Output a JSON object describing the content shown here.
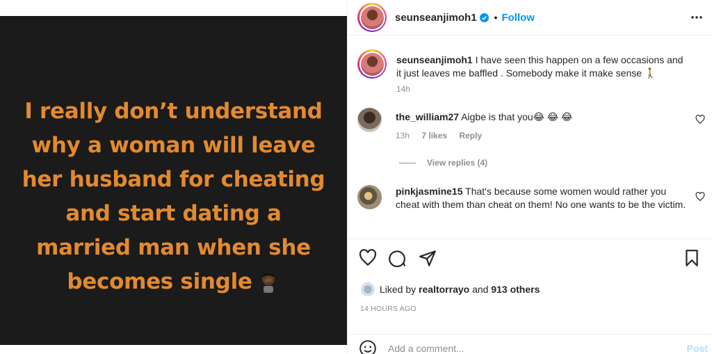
{
  "post_image": {
    "quote_lines": [
      "I really don’t understand",
      "why a woman will leave",
      "her husband for cheating",
      "and start dating a",
      "married man when she",
      "becomes single"
    ],
    "quote_color": "#e38a2f",
    "background": "#1b1b1b",
    "emoji_icon": "man-facepalming-icon"
  },
  "header": {
    "username": "seunseanjimoh1",
    "separator": "•",
    "follow_label": "Follow",
    "more_icon": "more-horizontal-icon"
  },
  "caption": {
    "username": "seunseanjimoh1",
    "text": "I have seen this happen on a few occasions and it just leaves me baffled . Somebody make it make sense 🚶",
    "time": "14h"
  },
  "comments": [
    {
      "username": "the_william27",
      "text": "Aigbe is that you😂 😂 😂",
      "time": "13h",
      "likes": "7 likes",
      "reply_label": "Reply",
      "view_replies": "View replies (4)"
    },
    {
      "username": "pinkjasmine15",
      "text": "That's because some women would rather you cheat with them than cheat on them! No one wants to be the victim."
    }
  ],
  "likes": {
    "prefix": "Liked by",
    "liker": "realtorrayo",
    "and": "and",
    "others": "913 others"
  },
  "timestamp": "14 HOURS AGO",
  "add_comment": {
    "placeholder": "Add a comment...",
    "post_label": "Post"
  },
  "colors": {
    "accent": "#0095f6",
    "post_disabled": "#b2dffc",
    "muted": "#8e8e8e"
  }
}
